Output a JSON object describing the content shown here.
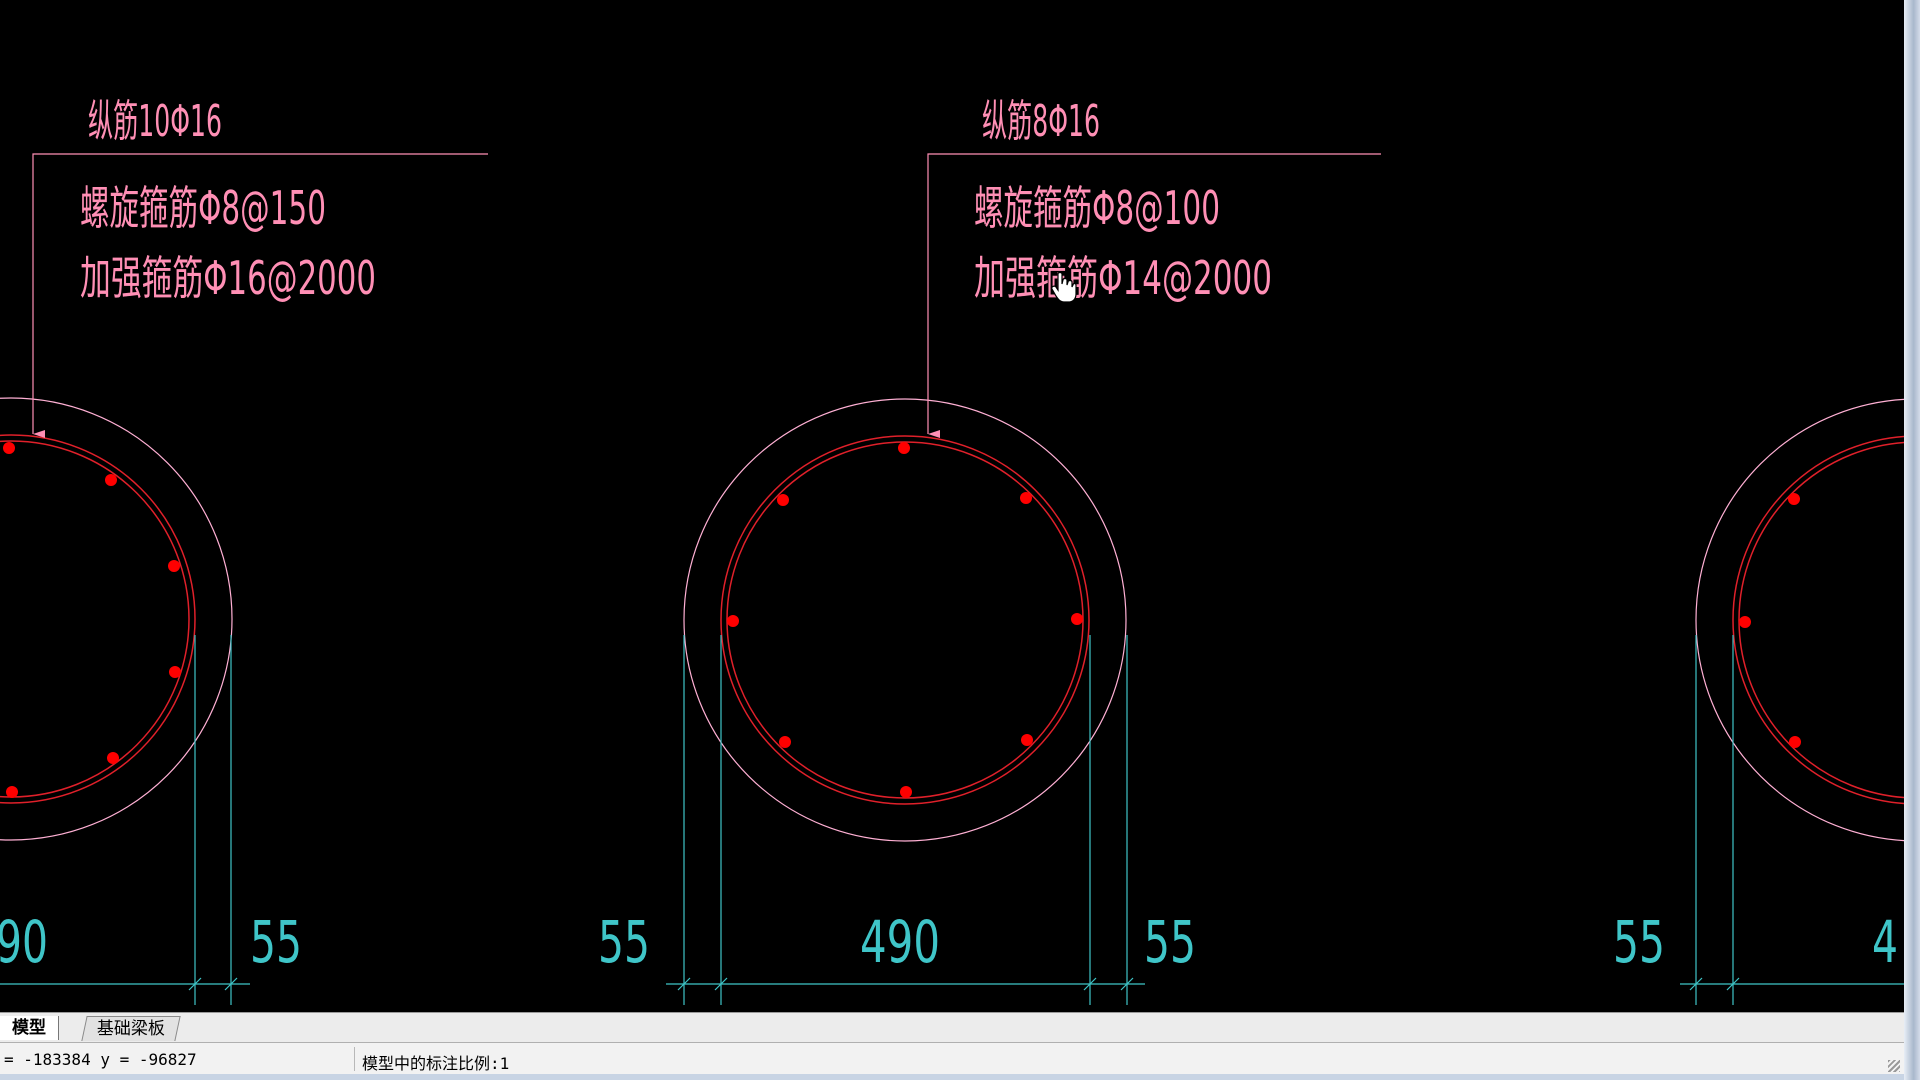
{
  "labels": {
    "left": {
      "longitudinal": "纵筋10Φ16",
      "spiral": "螺旋箍筋Φ8@150",
      "reinforce": "加强箍筋Φ16@2000"
    },
    "middle": {
      "longitudinal": "纵筋8Φ16",
      "spiral": "螺旋箍筋Φ8@100",
      "reinforce": "加强箍筋Φ14@2000"
    }
  },
  "dimensions": {
    "left_inner_partial": "90",
    "left_cover": "55",
    "middle_left_cover": "55",
    "middle_inner": "490",
    "middle_right_cover": "55",
    "right_left_cover": "55",
    "right_inner_partial": "4"
  },
  "tabs": {
    "model": "模型",
    "layout": "基础梁板"
  },
  "status": {
    "coordinates": "= -183384 y = -96827",
    "scale_note": "模型中的标注比例:1"
  },
  "colors": {
    "background": "#000000",
    "annotation": "#ff8fb5",
    "outer_circle": "#ffb0d4",
    "stirrup": "#e0202a",
    "rebar_dot": "#ff0000",
    "dimension": "#3fc5c8"
  },
  "icons": {
    "cursor": "hand-pointer-icon"
  }
}
